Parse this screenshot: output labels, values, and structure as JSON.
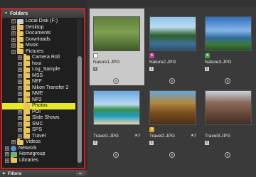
{
  "panel": {
    "title": "Folders",
    "filters_title": "Filters",
    "filters_control": "▸▸"
  },
  "tree": [
    {
      "label": "Local Disk (F:)",
      "indent": 1,
      "icon": "drive",
      "expander": "-"
    },
    {
      "label": "Desktop",
      "indent": 1,
      "icon": "folder",
      "expander": "+"
    },
    {
      "label": "Documents",
      "indent": 1,
      "icon": "folder",
      "expander": "+"
    },
    {
      "label": "Downloads",
      "indent": 1,
      "icon": "folder",
      "expander": "+"
    },
    {
      "label": "Music",
      "indent": 1,
      "icon": "folder",
      "expander": "+"
    },
    {
      "label": "Pictures",
      "indent": 1,
      "icon": "folder",
      "expander": "-"
    },
    {
      "label": "Camera Roll",
      "indent": 2,
      "icon": "folder",
      "expander": "+"
    },
    {
      "label": "houi",
      "indent": 2,
      "icon": "folder",
      "expander": "+"
    },
    {
      "label": "Log_Sample",
      "indent": 2,
      "icon": "folder",
      "expander": "+"
    },
    {
      "label": "MSS",
      "indent": 2,
      "icon": "folder",
      "expander": "+"
    },
    {
      "label": "NEF",
      "indent": 2,
      "icon": "folder",
      "expander": "+"
    },
    {
      "label": "Nikon Transfer 2",
      "indent": 2,
      "icon": "folder",
      "expander": "+"
    },
    {
      "label": "NME",
      "indent": 2,
      "icon": "folder",
      "expander": "+"
    },
    {
      "label": "NP2",
      "indent": 2,
      "icon": "folder",
      "expander": "+"
    },
    {
      "label": "Photos",
      "indent": 2,
      "icon": "folder",
      "expander": "",
      "selected": true
    },
    {
      "label": "POI",
      "indent": 2,
      "icon": "folder",
      "expander": "+"
    },
    {
      "label": "Slide Shows",
      "indent": 2,
      "icon": "folder",
      "expander": "+"
    },
    {
      "label": "SMC",
      "indent": 2,
      "icon": "folder",
      "expander": "+"
    },
    {
      "label": "SPS",
      "indent": 2,
      "icon": "folder",
      "expander": "+"
    },
    {
      "label": "Travel",
      "indent": 2,
      "icon": "folder",
      "expander": "+"
    },
    {
      "label": "Videos",
      "indent": 1,
      "icon": "folder",
      "expander": "+"
    },
    {
      "label": "Network",
      "indent": 0,
      "icon": "network",
      "expander": "+"
    },
    {
      "label": "Homegroup",
      "indent": 0,
      "icon": "homegroup",
      "expander": "+"
    },
    {
      "label": "Libraries",
      "indent": 0,
      "icon": "folder",
      "expander": "+"
    }
  ],
  "thumbnails": [
    {
      "filename": "Nature1.JPG",
      "label_num": "",
      "label_color": "#ffffff",
      "rating": "",
      "selected": true,
      "scene": "bird"
    },
    {
      "filename": "Nature2.JPG",
      "label_num": "5",
      "label_color": "#c0409a",
      "rating": "",
      "selected": false,
      "scene": "lake"
    },
    {
      "filename": "Nature3.JPG",
      "label_num": "4",
      "label_color": "#3fa34a",
      "rating": "",
      "selected": false,
      "scene": "coast"
    },
    {
      "filename": "Travel1.JPG",
      "label_num": "",
      "label_color": "",
      "rating": "★3",
      "selected": false,
      "scene": "beach"
    },
    {
      "filename": "Travel2.JPG",
      "label_num": "3",
      "label_color": "#e0a21a",
      "rating": "★3",
      "selected": false,
      "scene": "statue"
    },
    {
      "filename": "Travel3.JPG",
      "label_num": "",
      "label_color": "",
      "rating": "",
      "selected": false,
      "scene": "street"
    }
  ]
}
